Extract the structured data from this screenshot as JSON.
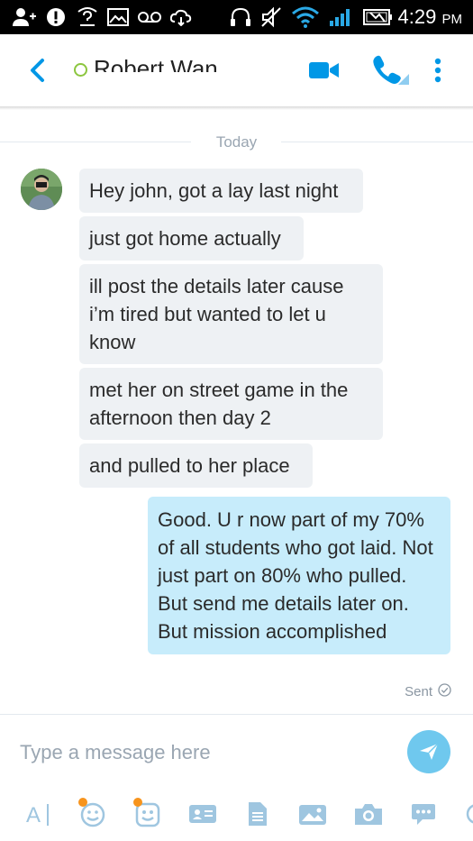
{
  "status_bar": {
    "time": "4:29",
    "ampm": "PM",
    "icons": [
      "add-person-icon",
      "alert-icon",
      "wifi-question-icon",
      "image-icon",
      "voicemail-icon",
      "cloud-sync-icon",
      "headset-icon",
      "mute-icon",
      "wifi-icon",
      "signal-icon",
      "battery-icon"
    ]
  },
  "header": {
    "contact_name": "Robert Wan",
    "icons": [
      "back-arrow-icon",
      "presence-icon",
      "video-call-icon",
      "audio-call-icon",
      "more-options-icon"
    ]
  },
  "date_divider": "Today",
  "messages": [
    {
      "direction": "incoming",
      "text": "Hey john, got a lay last night"
    },
    {
      "direction": "incoming",
      "text": "just got home actually"
    },
    {
      "direction": "incoming",
      "text": "ill post the details later  cause i’m tired but wanted to let u know"
    },
    {
      "direction": "incoming",
      "text": "met her on street game  in the afternoon then day 2"
    },
    {
      "direction": "incoming",
      "text": "and pulled to her place"
    },
    {
      "direction": "outgoing",
      "text": "Good. U r now part of my 70% of all students who got laid. Not just part on 80% who pulled. But send me details later on. But mission accomplished"
    }
  ],
  "sent_status": "Sent",
  "composer": {
    "placeholder": "Type a message here",
    "tools": [
      "text-format-icon",
      "emoji-icon",
      "sticker-icon",
      "contact-card-icon",
      "file-icon",
      "photo-icon",
      "camera-icon",
      "chat-bubble-icon"
    ]
  },
  "colors": {
    "accent": "#0097e6",
    "incoming_bubble": "#eef1f4",
    "outgoing_bubble": "#c7ecfb",
    "send_button": "#6fc8ee",
    "notification_dot": "#f7941d",
    "presence": "#8cc63f"
  }
}
